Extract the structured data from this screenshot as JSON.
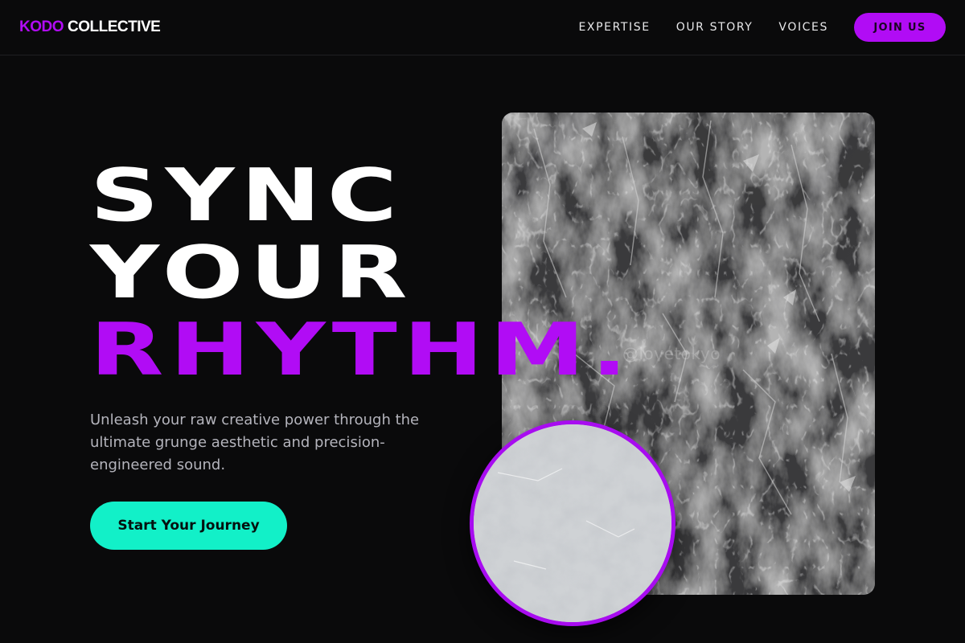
{
  "header": {
    "logo_accent": "KODO",
    "logo_main": "COLLECTIVE",
    "nav": [
      {
        "label": "EXPERTISE"
      },
      {
        "label": "OUR STORY"
      },
      {
        "label": "VOICES"
      }
    ],
    "join_label": "JOIN US"
  },
  "hero": {
    "title_line1": "SYNC",
    "title_line2": "YOUR",
    "title_line3": "RHYTHM.",
    "subtitle": "Unleash your raw creative power through the ultimate grunge aesthetic and precision-engineered sound.",
    "cta_label": "Start Your Journey",
    "image_watermark": "@lovetokyo"
  },
  "colors": {
    "background": "#0a0a0b",
    "accent_purple": "#b10cf5",
    "accent_teal": "#12f0c8",
    "text_muted": "#b4b4bc"
  }
}
